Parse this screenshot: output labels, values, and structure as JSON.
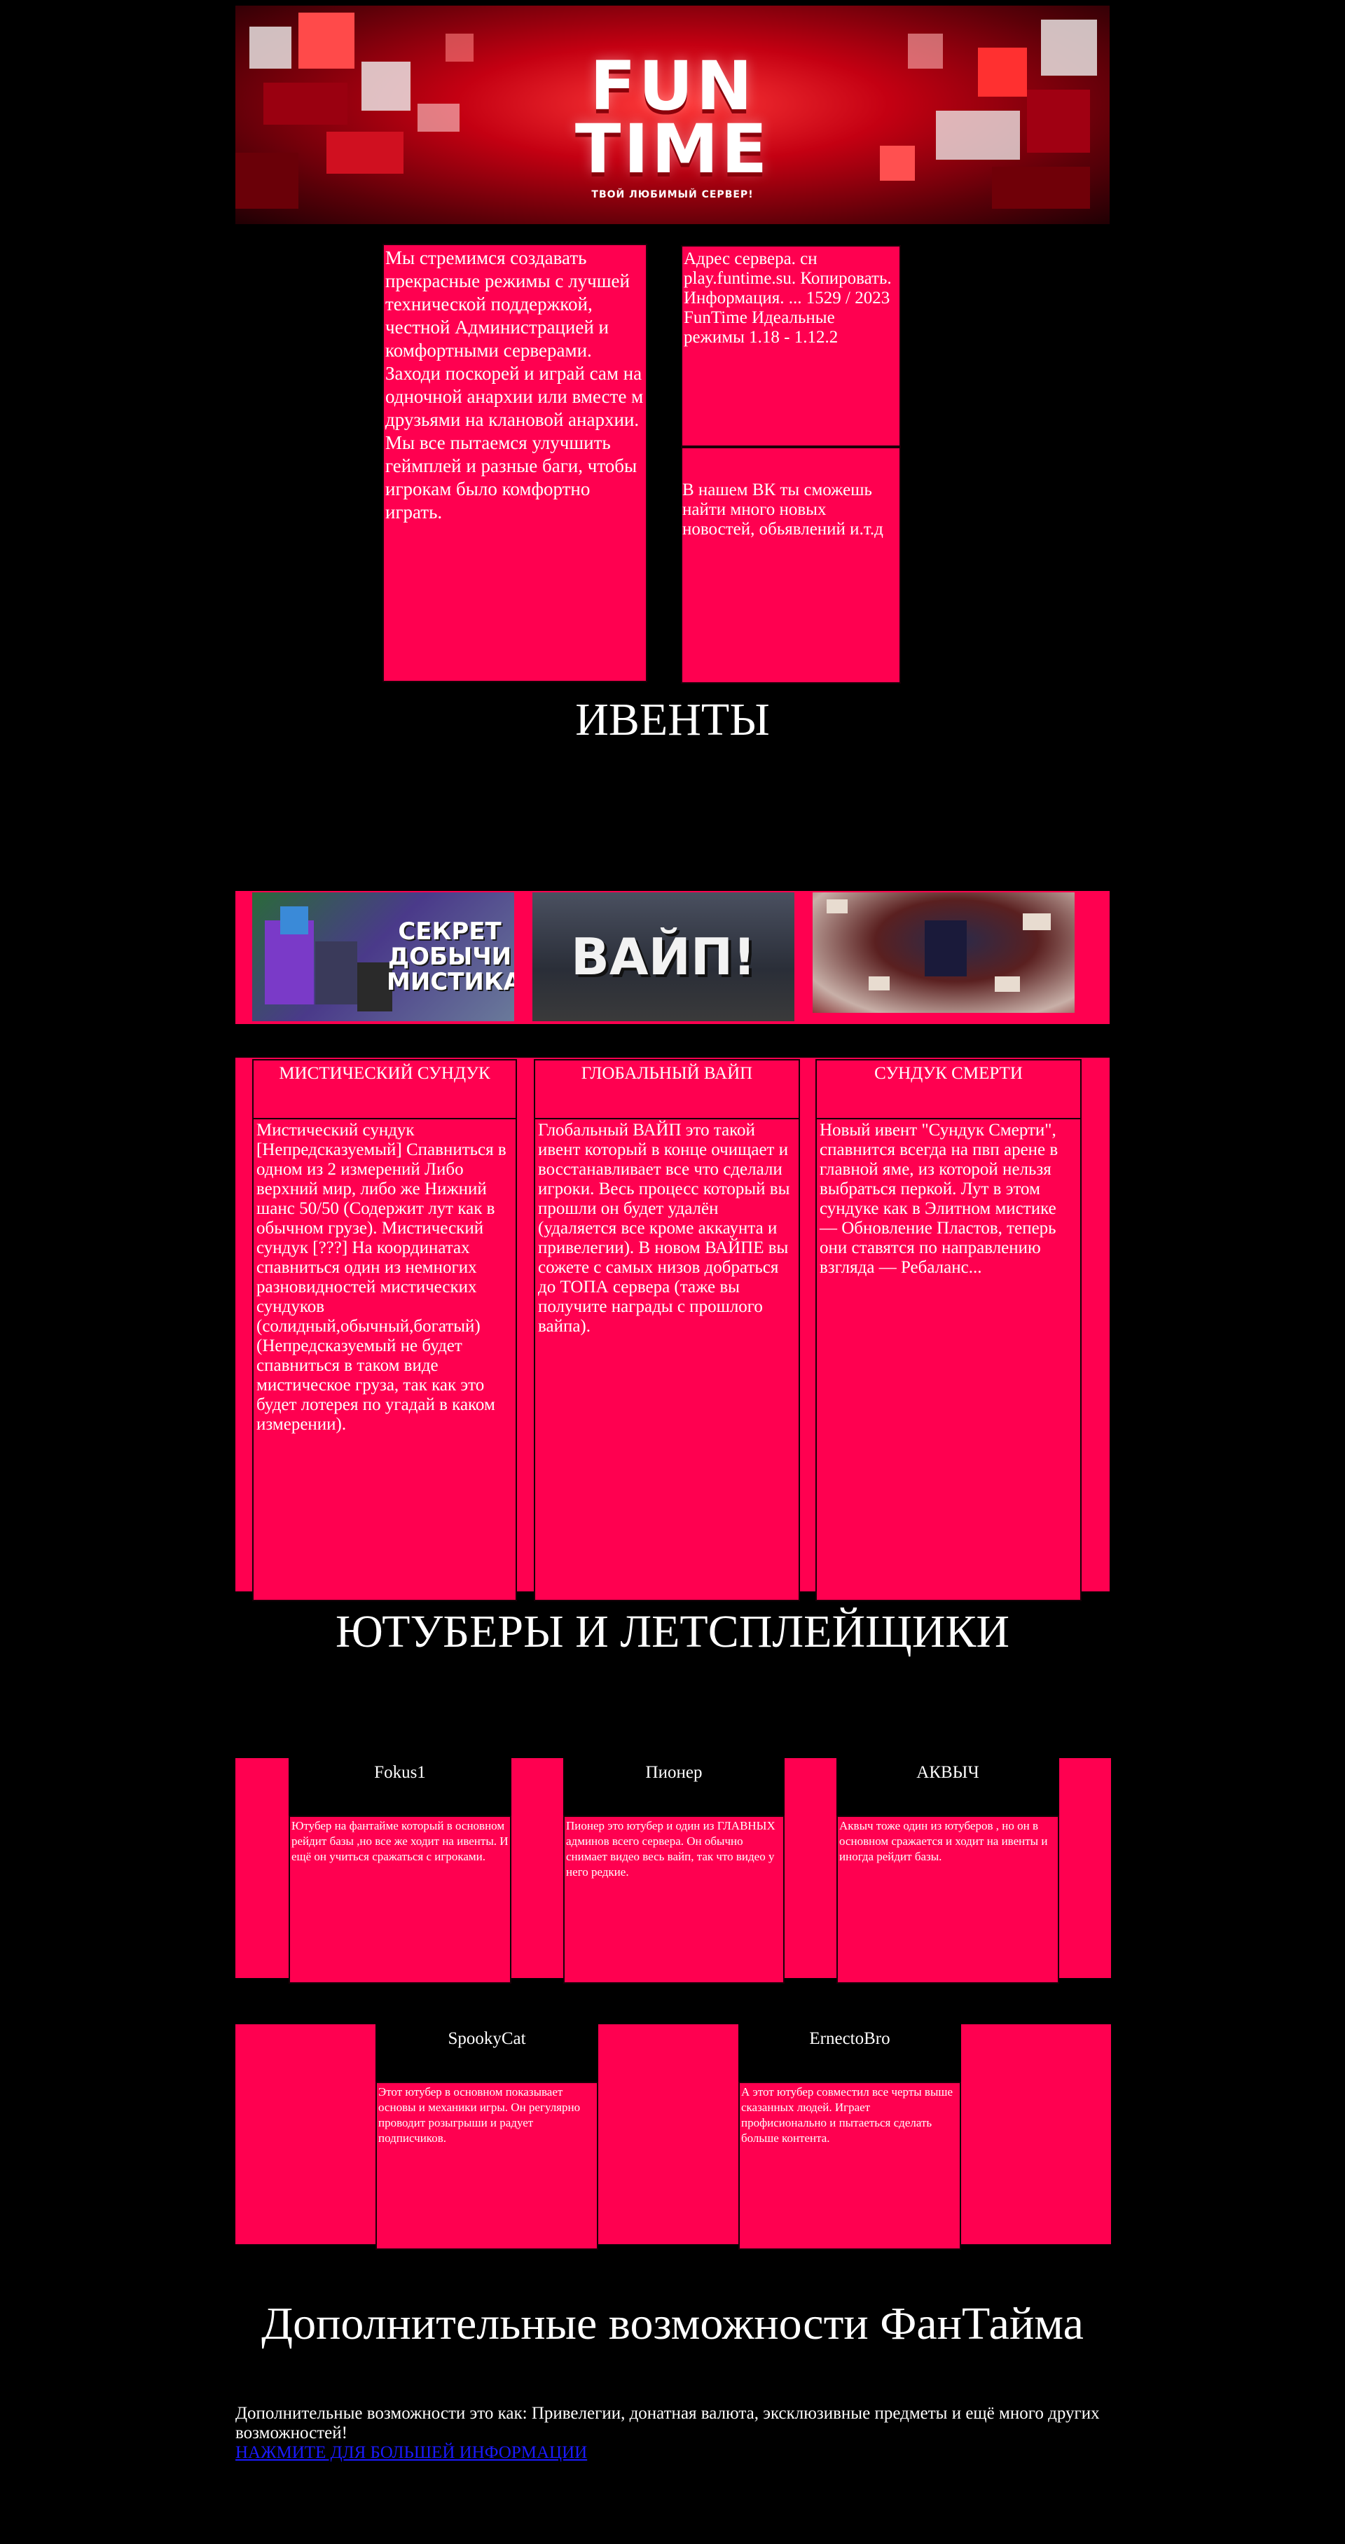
{
  "banner": {
    "logo_line1": "FUN",
    "logo_line2": "TIME",
    "tagline": "ТВОЙ ЛЮБИМЫЙ СЕРВЕР!"
  },
  "about": {
    "text": "Мы стремимся создавать прекрасные режимы с лучшей технической поддержкой, честной Администрацией и комфортными серверами. Заходи поскорей и играй сам на одночной анархии или вместе м друзьями на клановой анархии. Мы все пытаемся улучшить геймплей и разные баги, чтобы игрокам было комфортно играть."
  },
  "server": {
    "text": "Адрес сервера. сн play.funtime.su. Копировать. Информация. ... 1529 / 2023 FunTime Идеальные режимы 1.18 - 1.12.2"
  },
  "vk": {
    "text": "В нашем ВК ты сможешь найти много новых новостей, обьявлений и.т.д"
  },
  "events_heading": "ИВЕНТЫ",
  "events": [
    {
      "image_caption_line1": "СЕКРЕТ",
      "image_caption_line2": "ДОБЫЧИ",
      "image_caption_line3": "МИСТИКА",
      "title": "МИСТИЧЕСКИЙ СУНДУК",
      "text": "Мистический сундук [Непредсказуемый] Спавниться в одном из 2 измерений Либо верхний мир, либо же Нижний шанс 50/50 (Содержит лут как в обычном грузе). Мистический сундук [???] На координатах спавниться один из немногих разновидностей мистических сундуков (солидный,обычный,богатый) (Непредсказуемый не будет спавниться в таком виде мистическое груза, так как это будет лотерея по угадай в каком измерении)."
    },
    {
      "image_caption_line1": "ВАЙП!",
      "title": "ГЛОБАЛЬНЫЙ ВАЙП",
      "text": "Глобальный ВАЙП это такой ивент который в конце очищает и восстанавливает все что сделали игроки. Весь процесс который вы прошли он будет удалён (удаляется все кроме аккаунта и привелегии). В новом ВАЙПЕ вы сожете с самых низов добраться до ТОПА сервера (таже вы получите награды с прошлого вайпа)."
    },
    {
      "title": "СУНДУК СМЕРТИ",
      "text": "Новый ивент \"Сундук Смерти\", спавнится всегда на пвп арене в главной яме, из которой нельзя выбраться перкой. Лут в этом сундуке как в Элитном мистике — Обновление Пластов, теперь они ставятся по направлению взгляда — Ребаланс..."
    }
  ],
  "youtubers_heading": "ЮТУБЕРЫ И ЛЕТСПЛЕЙЩИКИ",
  "youtubers_row1": [
    {
      "name": "Fokus1",
      "text": "Ютубер на фантайме который в основном рейдит базы ,но все же ходит на ивенты. И ещё он учиться сражаться с игроками."
    },
    {
      "name": "Пионер",
      "text": "Пионер это ютубер и один из ГЛАВНЫХ админов всего сервера. Он обычно снимает видео весь вайп, так что видео у него редкие."
    },
    {
      "name": "АКВЫЧ",
      "text": "Аквыч тоже один из ютуберов , но он в основном сражается и ходит на ивенты и иногда рейдит базы."
    }
  ],
  "youtubers_row2": [
    {
      "name": "SpookyCat",
      "text": "Этот ютубер в основном показывает основы и механики игры. Он регулярно проводит розыгрыши и радует подписчиков."
    },
    {
      "name": "ErnectoBro",
      "text": "А этот ютубер совместил все черты выше сказанных людей. Играет профисионально и пытаеться сделать больше контента."
    }
  ],
  "extra": {
    "heading": "Дополнительные возможности ФанТайма",
    "text": "Дополнительные возможности это как: Привелегии, донатная валюта, эксклюзивные предметы и ещё много других возможностей!",
    "link_label": "НАЖМИТЕ ДЛЯ БОЛЬШЕЙ ИНФОРМАЦИИ"
  },
  "colors": {
    "background": "#000000",
    "accent_pink": "#ff0050",
    "link": "#1a1aff",
    "text": "#ffffff"
  }
}
